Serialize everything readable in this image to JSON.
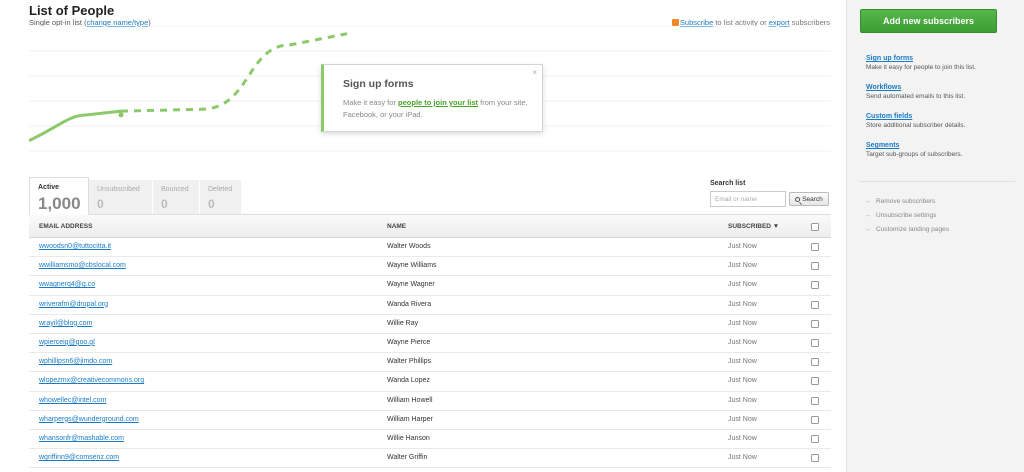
{
  "header": {
    "title": "List of People",
    "subtitle_prefix": "Single opt-in list (",
    "subtitle_link": "change name/type",
    "subtitle_suffix": ")",
    "subscribe_link": "Subscribe",
    "subscribe_middle": " to list activity or ",
    "export_link": "export",
    "export_suffix": " subscribers"
  },
  "chart_data": {
    "type": "line",
    "series": [
      {
        "values": [
          2,
          9,
          10,
          10.5,
          28,
          31
        ]
      }
    ],
    "color": "#8cc96b",
    "grid": true
  },
  "popover": {
    "title": "Sign up forms",
    "text_before": "Make it easy for ",
    "link": "people to join your list",
    "text_after": " from your site, Facebook, or your iPad.",
    "close": "×"
  },
  "tabs": [
    {
      "label": "Active",
      "count": "1,000"
    },
    {
      "label": "Unsubscribed",
      "count": "0"
    },
    {
      "label": "Bounced",
      "count": "0"
    },
    {
      "label": "Deleted",
      "count": "0"
    }
  ],
  "search": {
    "label": "Search list",
    "placeholder": "Email or name",
    "button": "Search"
  },
  "table": {
    "columns": {
      "email": "EMAIL ADDRESS",
      "name": "NAME",
      "subscribed": "SUBSCRIBED",
      "sort_indicator": "▼"
    },
    "rows": [
      {
        "email": "wwoodsn0@tuttocitta.it",
        "name": "Walter Woods",
        "subscribed": "Just Now"
      },
      {
        "email": "wwilliamsmo@cbslocal.com",
        "name": "Wayne Williams",
        "subscribed": "Just Now"
      },
      {
        "email": "wwagnerq4@g.co",
        "name": "Wayne Wagner",
        "subscribed": "Just Now"
      },
      {
        "email": "wriverafm@drupal.org",
        "name": "Wanda Rivera",
        "subscribed": "Just Now"
      },
      {
        "email": "wrayil@blog.com",
        "name": "Willie Ray",
        "subscribed": "Just Now"
      },
      {
        "email": "wpierceig@goo.gl",
        "name": "Wayne Pierce",
        "subscribed": "Just Now"
      },
      {
        "email": "wphillipsn6@jimdo.com",
        "name": "Walter Phillips",
        "subscribed": "Just Now"
      },
      {
        "email": "wlopezmx@creativecommons.org",
        "name": "Wanda Lopez",
        "subscribed": "Just Now"
      },
      {
        "email": "whowellec@intel.com",
        "name": "William Howell",
        "subscribed": "Just Now"
      },
      {
        "email": "wharpergs@wunderground.com",
        "name": "William Harper",
        "subscribed": "Just Now"
      },
      {
        "email": "whansonfr@mashable.com",
        "name": "Willie Hanson",
        "subscribed": "Just Now"
      },
      {
        "email": "wgriffinn9@comsenz.com",
        "name": "Walter Griffin",
        "subscribed": "Just Now"
      }
    ]
  },
  "sidebar": {
    "add_button": "Add new subscribers",
    "links": [
      {
        "label": "Sign up forms",
        "desc": "Make it easy for people to join this list."
      },
      {
        "label": "Workflows",
        "desc": "Send automated emails to this list."
      },
      {
        "label": "Custom fields",
        "desc": "Store additional subscriber details."
      },
      {
        "label": "Segments",
        "desc": "Target sub-groups of subscribers."
      }
    ],
    "actions": [
      {
        "label": "Remove subscribers"
      },
      {
        "label": "Unsubscribe settings"
      },
      {
        "label": "Customize landing pages"
      }
    ],
    "arrow": "→"
  }
}
